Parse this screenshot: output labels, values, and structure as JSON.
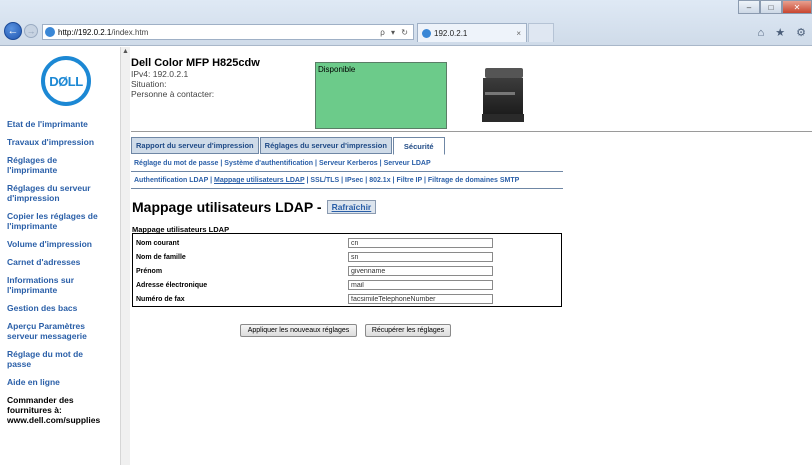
{
  "browser": {
    "url_host": "http://192.0.2.1",
    "url_path": "/index.htm",
    "addr_controls": "ρ ▾ ↻",
    "tab_title": "192.0.2.1",
    "tab_close": "×",
    "back": "←",
    "forward": "→",
    "win_min": "–",
    "win_max": "□",
    "win_close": "✕",
    "tools": "⌂ ★ ⚙"
  },
  "logo": "DØLL",
  "sidebar": {
    "items": [
      {
        "label": "Etat de l'imprimante"
      },
      {
        "label": "Travaux d'impression"
      },
      {
        "label": "Réglages de l'imprimante"
      },
      {
        "label": "Réglages du serveur d'impression"
      },
      {
        "label": "Copier les réglages de l'imprimante"
      },
      {
        "label": "Volume d'impression"
      },
      {
        "label": "Carnet d'adresses"
      },
      {
        "label": "Informations sur l'imprimante"
      },
      {
        "label": "Gestion des bacs"
      },
      {
        "label": "Aperçu Paramètres serveur messagerie"
      },
      {
        "label": "Réglage du mot de passe"
      },
      {
        "label": "Aide en ligne"
      },
      {
        "label": "Commander des fournitures à: www.dell.com/supplies"
      }
    ]
  },
  "header": {
    "model": "Dell Color MFP H825cdw",
    "ipv4": "IPv4: 192.0.2.1",
    "situation": "Situation:",
    "contact": "Personne à contacter:",
    "status": "Disponible"
  },
  "tabs": [
    {
      "label": "Rapport du serveur d'impression"
    },
    {
      "label": "Réglages du serveur d'impression"
    },
    {
      "label": "Sécurité"
    }
  ],
  "sublinks1": [
    "Réglage du mot de passe",
    "Système d'authentification",
    "Serveur Kerberos",
    "Serveur LDAP"
  ],
  "sublinks2": [
    "Authentification LDAP",
    "Mappage utilisateurs LDAP",
    "SSL/TLS",
    "IPsec",
    "802.1x",
    "Filtre IP",
    "Filtrage de domaines SMTP"
  ],
  "sep": " | ",
  "page": {
    "title": "Mappage utilisateurs LDAP -",
    "refresh": "Rafraîchir",
    "section": "Mappage utilisateurs LDAP"
  },
  "fields": [
    {
      "label": "Nom courant",
      "value": "cn"
    },
    {
      "label": "Nom de famille",
      "value": "sn"
    },
    {
      "label": "Prénom",
      "value": "givenname"
    },
    {
      "label": "Adresse électronique",
      "value": "mail"
    },
    {
      "label": "Numéro de fax",
      "value": "facsimileTelephoneNumber"
    }
  ],
  "buttons": {
    "apply": "Appliquer les nouveaux réglages",
    "restore": "Récupérer les réglages"
  }
}
